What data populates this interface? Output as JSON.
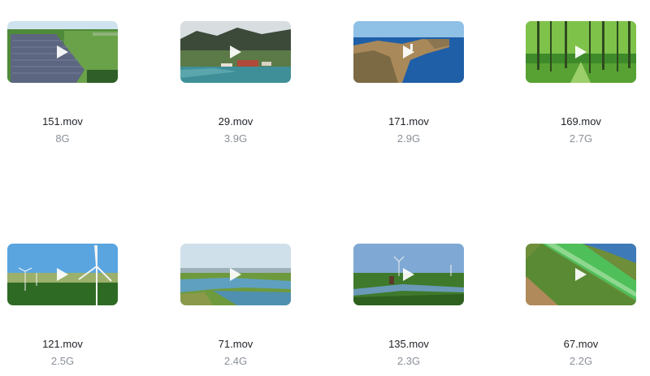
{
  "videos": [
    {
      "name": "151.mov",
      "size": "8G",
      "thumbnail": "solar-farm-aerial"
    },
    {
      "name": "29.mov",
      "size": "3.9G",
      "thumbnail": "coastal-harbor-mountains"
    },
    {
      "name": "171.mov",
      "size": "2.9G",
      "thumbnail": "sea-cliffs-lighthouse"
    },
    {
      "name": "169.mov",
      "size": "2.7G",
      "thumbnail": "green-forest"
    },
    {
      "name": "121.mov",
      "size": "2.5G",
      "thumbnail": "wind-turbines-fields"
    },
    {
      "name": "71.mov",
      "size": "2.4G",
      "thumbnail": "river-wetlands"
    },
    {
      "name": "135.mov",
      "size": "2.3G",
      "thumbnail": "windmills-canal"
    },
    {
      "name": "67.mov",
      "size": "2.2G",
      "thumbnail": "dike-fields-water"
    }
  ]
}
